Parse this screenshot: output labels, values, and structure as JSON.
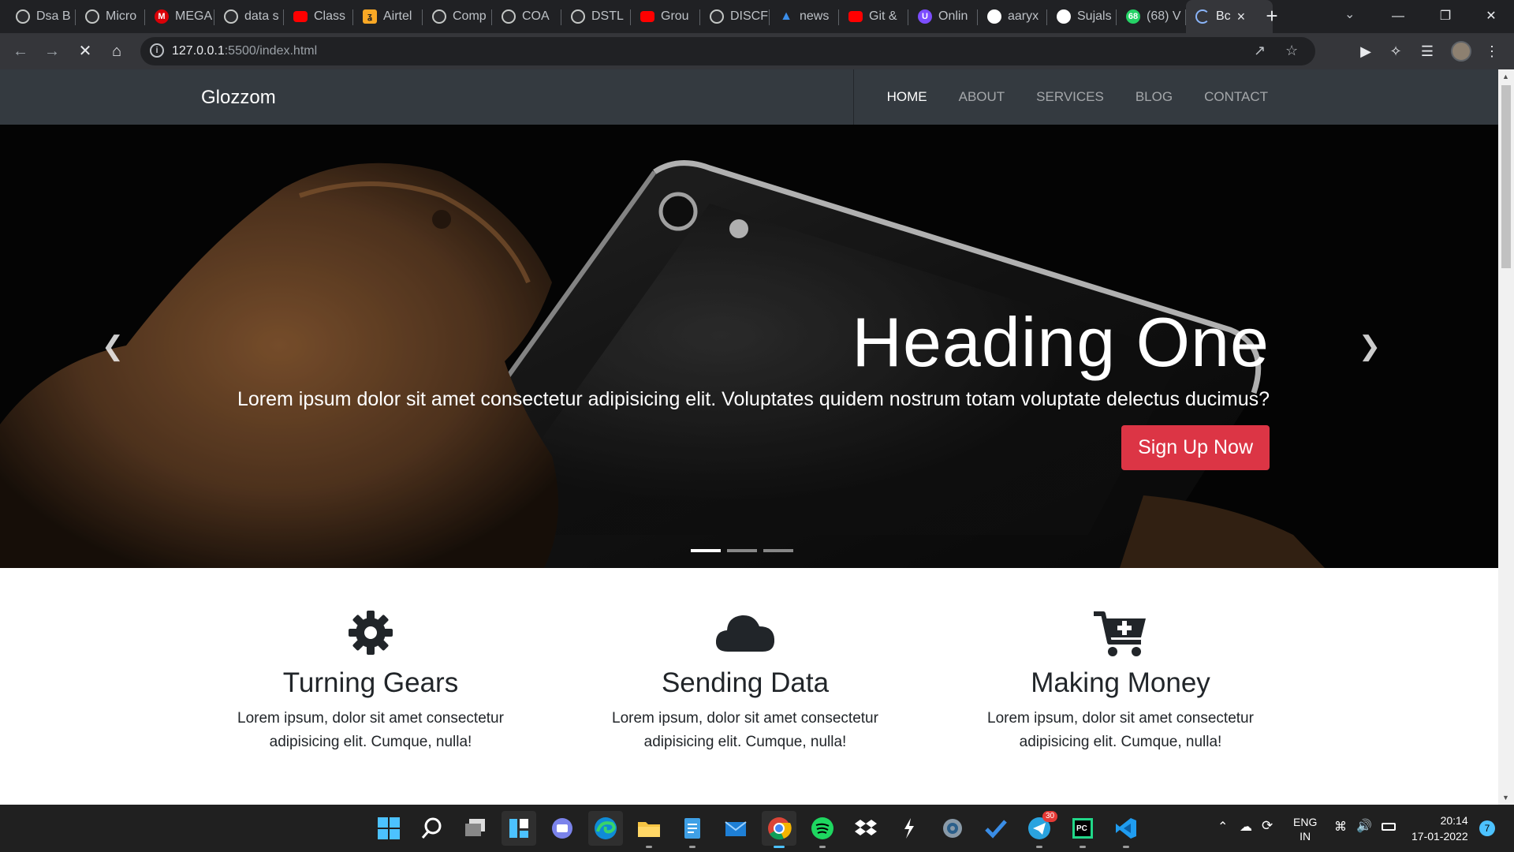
{
  "browser": {
    "tabs": [
      {
        "label": "Dsa B",
        "icon": "globe-icon",
        "kind": "globe"
      },
      {
        "label": "Micro",
        "icon": "globe-icon",
        "kind": "globe"
      },
      {
        "label": "MEGA",
        "icon": "mega-icon",
        "kind": "mega"
      },
      {
        "label": "data s",
        "icon": "globe-icon",
        "kind": "globe"
      },
      {
        "label": "Class",
        "icon": "youtube-icon",
        "kind": "yt"
      },
      {
        "label": "Airtel",
        "icon": "airtel-icon",
        "kind": "airtel"
      },
      {
        "label": "Comp",
        "icon": "globe-icon",
        "kind": "globe"
      },
      {
        "label": "COA",
        "icon": "globe-icon",
        "kind": "globe"
      },
      {
        "label": "DSTL",
        "icon": "globe-icon",
        "kind": "globe"
      },
      {
        "label": "Grou",
        "icon": "youtube-icon",
        "kind": "yt"
      },
      {
        "label": "DISCF",
        "icon": "globe-icon",
        "kind": "globe"
      },
      {
        "label": "news",
        "icon": "azure-icon",
        "kind": "azure"
      },
      {
        "label": "Git &",
        "icon": "youtube-icon",
        "kind": "yt"
      },
      {
        "label": "Onlin",
        "icon": "unstop-icon",
        "kind": "purple"
      },
      {
        "label": "aaryx",
        "icon": "github-icon",
        "kind": "gh"
      },
      {
        "label": "Sujals",
        "icon": "github-icon",
        "kind": "gh"
      },
      {
        "label": "(68) V",
        "icon": "whatsapp-icon",
        "kind": "wa"
      },
      {
        "label": "Bc",
        "icon": "loading-spinner-icon",
        "kind": "loading",
        "active": true
      }
    ],
    "address": {
      "host": "127.0.0.1",
      "path": ":5500/index.html"
    }
  },
  "site": {
    "brand": "Glozzom",
    "nav": [
      "HOME",
      "ABOUT",
      "SERVICES",
      "BLOG",
      "CONTACT"
    ],
    "active_nav": "HOME",
    "carousel": {
      "heading": "Heading One",
      "text": "Lorem ipsum dolor sit amet consectetur adipisicing elit. Voluptates quidem nostrum totam voluptate delectus ducimus?",
      "button": "Sign Up Now",
      "slides_count": 3,
      "active_slide": 1,
      "prev_icon": "chevron-left-icon",
      "next_icon": "chevron-right-icon"
    },
    "features": [
      {
        "icon": "gear-icon",
        "title": "Turning Gears",
        "text": "Lorem ipsum, dolor sit amet consectetur adipisicing elit. Cumque, nulla!"
      },
      {
        "icon": "cloud-icon",
        "title": "Sending Data",
        "text": "Lorem ipsum, dolor sit amet consectetur adipisicing elit. Cumque, nulla!"
      },
      {
        "icon": "cart-plus-icon",
        "title": "Making Money",
        "text": "Lorem ipsum, dolor sit amet consectetur adipisicing elit. Cumque, nulla!"
      }
    ],
    "colors": {
      "navbar": "#343a40",
      "button": "#dc3545",
      "text": "#212529"
    }
  },
  "taskbar": {
    "apps": [
      "windows-start-icon",
      "search-icon",
      "task-view-icon",
      "widgets-icon",
      "teams-chat-icon",
      "edge-icon",
      "file-explorer-icon",
      "notepad-icon",
      "mail-icon",
      "chrome-icon",
      "spotify-icon",
      "dropbox-icon",
      "app-icon",
      "settings-icon",
      "todo-icon",
      "telegram-icon",
      "pycharm-icon",
      "vscode-icon"
    ],
    "telegram_badge": "30",
    "lang_top": "ENG",
    "lang_bottom": "IN",
    "time": "20:14",
    "date": "17-01-2022",
    "notification_count": "7"
  }
}
